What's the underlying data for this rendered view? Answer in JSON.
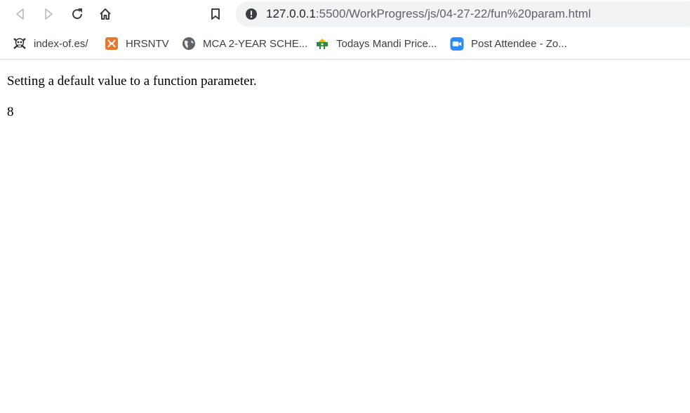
{
  "browser": {
    "url_host": "127.0.0.1",
    "url_rest": ":5500/WorkProgress/js/04-27-22/fun%20param.html",
    "nav_icons": [
      "back-icon",
      "forward-icon",
      "reload-icon",
      "home-icon",
      "bookmark-icon"
    ]
  },
  "bookmarks": [
    {
      "label": "index-of.es/",
      "icon": "skull-icon"
    },
    {
      "label": "HRSNTV",
      "icon": "hrsntv-logo-icon"
    },
    {
      "label": "MCA 2-YEAR SCHE...",
      "icon": "globe-icon"
    },
    {
      "label": "Todays Mandi Price...",
      "icon": "mandi-logo-icon"
    },
    {
      "label": "Post Attendee - Zo...",
      "icon": "zoom-icon"
    }
  ],
  "page": {
    "heading": "Setting a default value to a function parameter.",
    "output": "8"
  },
  "colors": {
    "accent_orange": "#e8772e",
    "zoom_blue": "#2d8cff",
    "address_bar_bg": "#f1f3f4"
  }
}
